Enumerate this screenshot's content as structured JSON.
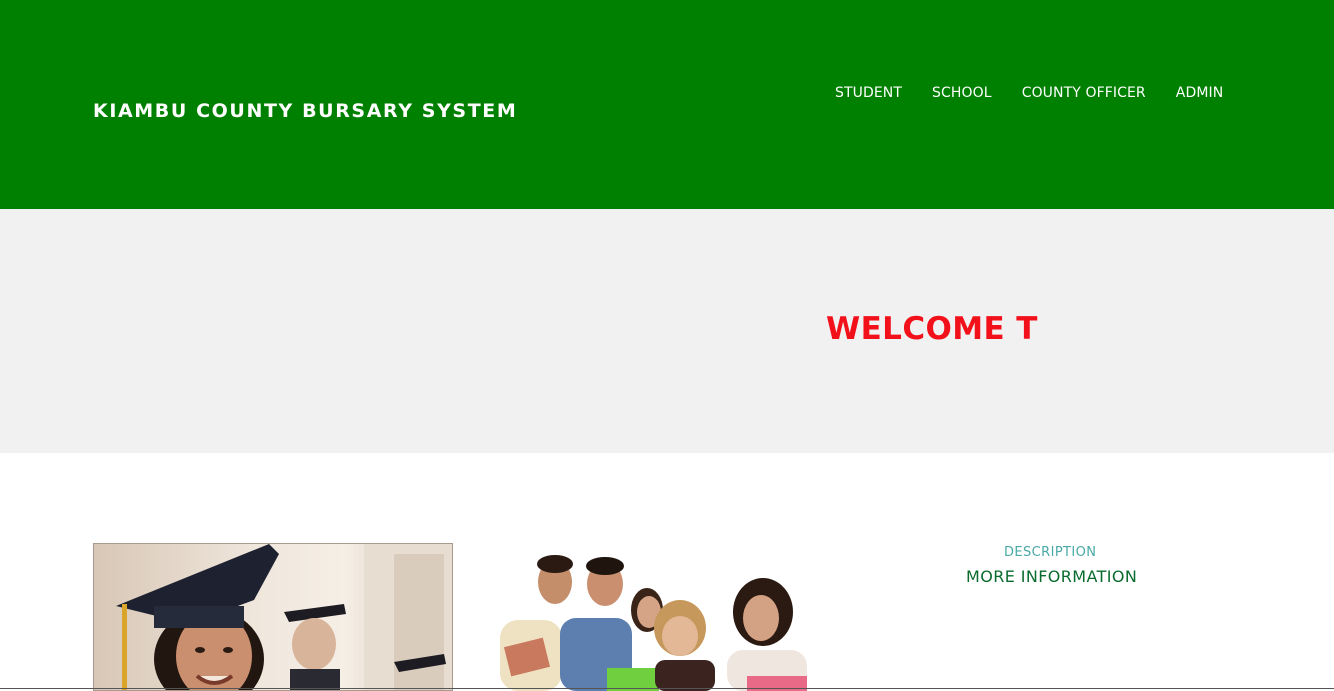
{
  "header": {
    "brand": "KIAMBU COUNTY BURSARY SYSTEM",
    "nav": [
      "STUDENT",
      "SCHOOL",
      "COUNTY OFFICER",
      "ADMIN"
    ]
  },
  "hero": {
    "welcome": "WELCOME TO KIAMBU COUNTY BURSARY SYSTEM"
  },
  "info": {
    "description": "DESCRIPTION",
    "more": "MORE INFORMATION"
  },
  "colors": {
    "header_bg": "#008000",
    "hero_bg": "#f1f1f1",
    "welcome_text": "#f2111b",
    "description_text": "#48a9a6",
    "more_text": "#0a6b2e"
  }
}
